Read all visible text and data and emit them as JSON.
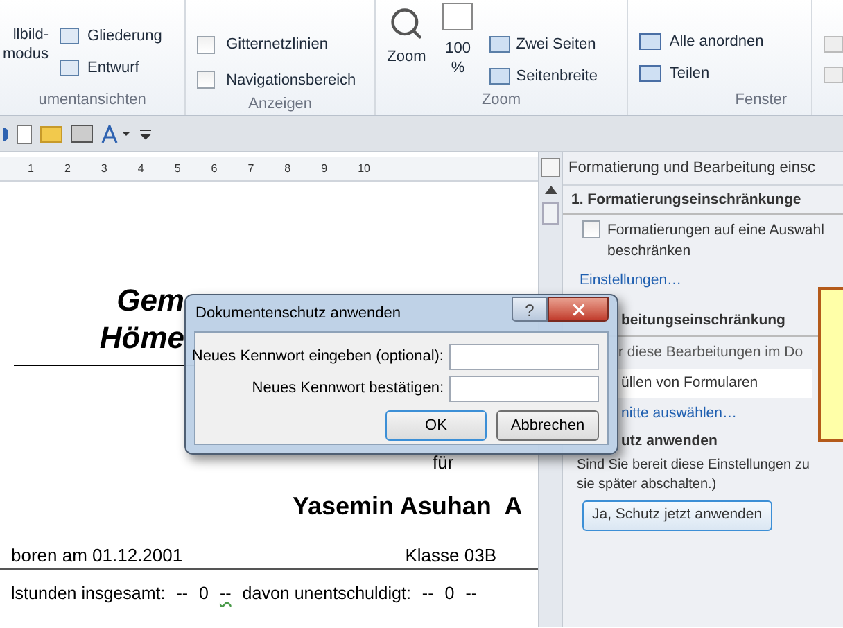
{
  "ribbon": {
    "groups": [
      {
        "kind": "views",
        "label": "umentansichten",
        "big_button": [
          "llbild-",
          "modus"
        ],
        "items": [
          "Gliederung",
          "Entwurf"
        ]
      },
      {
        "kind": "show",
        "label": "Anzeigen",
        "items": [
          {
            "label": "Gitternetzlinien",
            "checked": false
          },
          {
            "label": "Navigationsbereich",
            "checked": false
          }
        ]
      },
      {
        "kind": "zoom",
        "label": "Zoom",
        "zoom_button": "Zoom",
        "percent": [
          "100",
          "%"
        ],
        "items": [
          "Zwei Seiten",
          "Seitenbreite"
        ]
      },
      {
        "kind": "window",
        "label": "Fenster",
        "items": [
          "Alle anordnen",
          "Teilen"
        ]
      }
    ]
  },
  "ruler": [
    "1",
    "2",
    "3",
    "4",
    "5",
    "6",
    "7",
    "8",
    "9",
    "10"
  ],
  "document": {
    "title_lines": [
      "Gem",
      "Höme"
    ],
    "for": "für",
    "name": "Yasemin Asuhan  A",
    "born": "boren am 01.12.2001",
    "class": "Klasse 03B",
    "absence": [
      "lstunden insgesamt:",
      "--",
      "0",
      "--",
      "davon unentschuldigt:",
      "--",
      "0",
      "--"
    ]
  },
  "pane": {
    "title": "Formatierung und Bearbeitung einsc",
    "section1": "1. Formatierungseinschränkunge",
    "restrict": {
      "label": [
        "Formatierungen auf eine Auswahl",
        "beschränken"
      ],
      "checked": false
    },
    "settings_link": "Einstellungen…",
    "section2": "beitungseinschränkung",
    "allow_text": "r diese Bearbeitungen im Do",
    "allow_value": "üllen von Formularen",
    "exceptions_link": "nitte auswählen…",
    "section3": "utz anwenden",
    "ready_text": [
      "Sind Sie bereit diese Einstellungen zu",
      "sie später abschalten.)"
    ],
    "apply_button": "Ja, Schutz jetzt anwenden"
  },
  "dialog": {
    "title": "Dokumentenschutz anwenden",
    "help": "?",
    "fields": [
      {
        "label": "Neues Kennwort eingeben (optional):"
      },
      {
        "label": "Neues Kennwort bestätigen:"
      }
    ],
    "buttons": [
      {
        "label": "OK",
        "default": true
      },
      {
        "label": "Abbrechen",
        "default": false
      }
    ]
  }
}
